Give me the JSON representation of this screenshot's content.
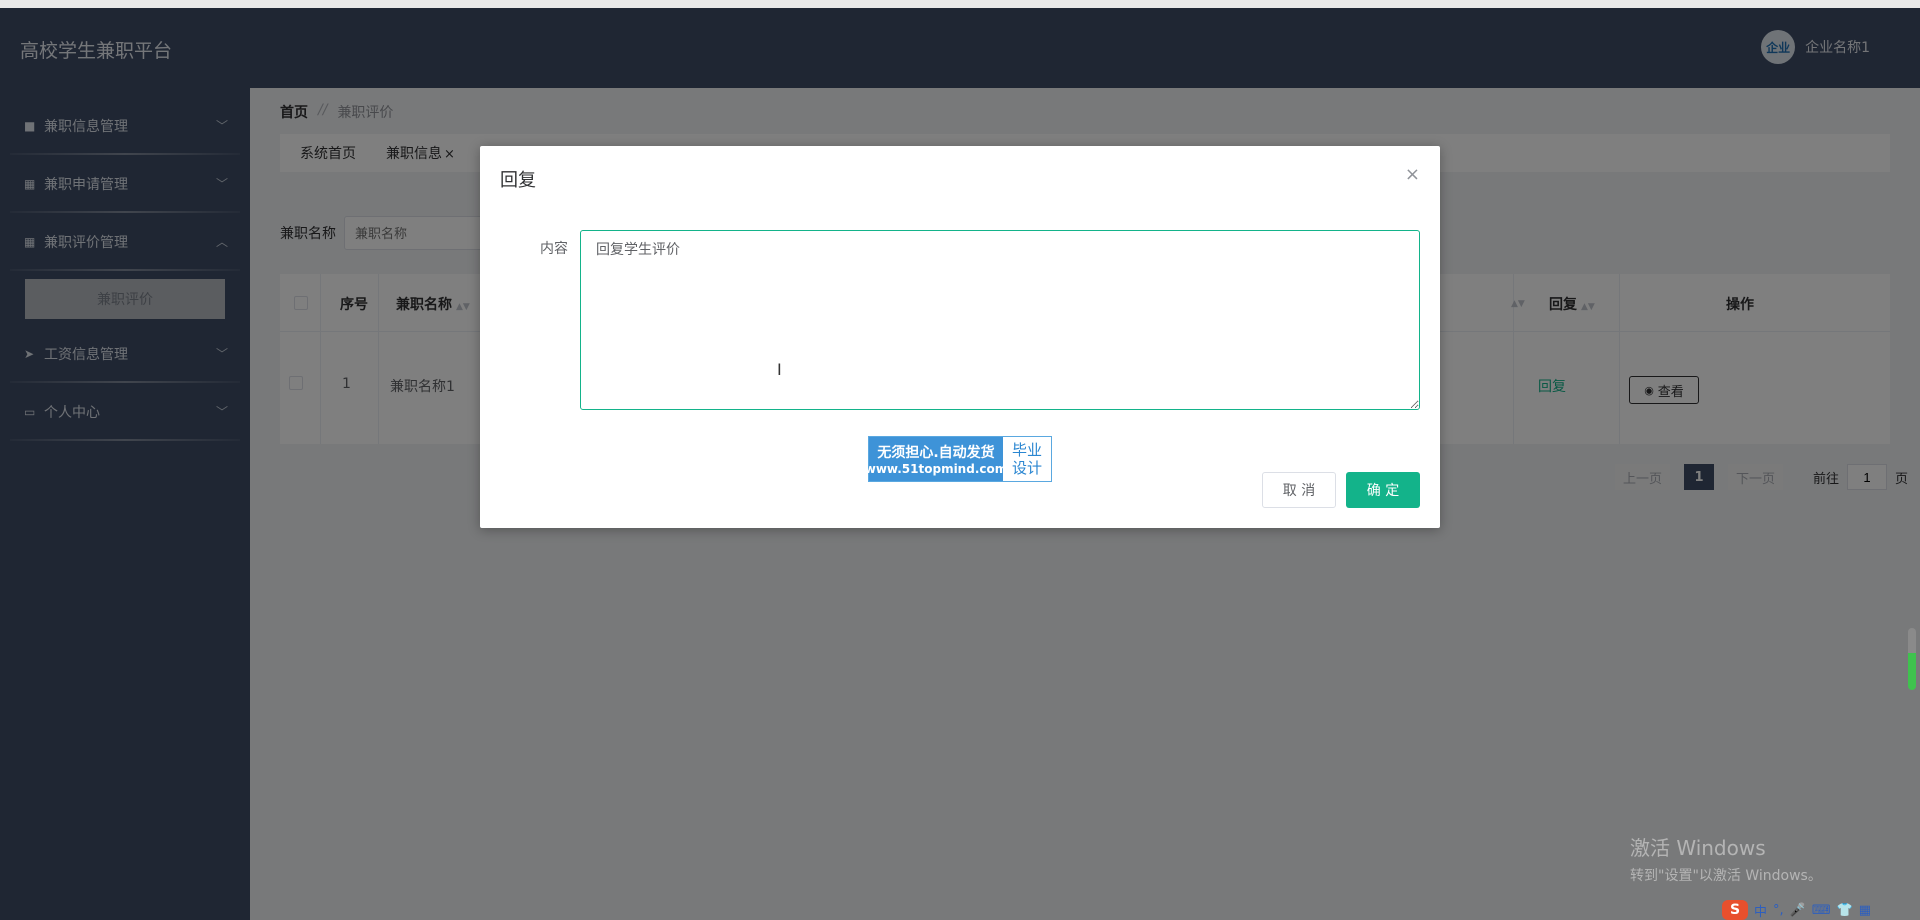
{
  "header": {
    "title": "高校学生兼职平台",
    "user_name": "企业名称1",
    "avatar_text": "企业"
  },
  "sidebar": {
    "items": [
      {
        "label": "兼职信息管理",
        "icon": "briefcase-icon",
        "expanded": false
      },
      {
        "label": "兼职申请管理",
        "icon": "grid-icon",
        "expanded": false
      },
      {
        "label": "兼职评价管理",
        "icon": "grid-icon",
        "expanded": true,
        "children": [
          {
            "label": "兼职评价"
          }
        ]
      },
      {
        "label": "工资信息管理",
        "icon": "paper-plane-icon",
        "expanded": false
      },
      {
        "label": "个人中心",
        "icon": "card-icon",
        "expanded": false
      }
    ]
  },
  "breadcrumb": {
    "home": "首页",
    "separator": "//",
    "current": "兼职评价"
  },
  "tags": [
    {
      "label": "系统首页"
    },
    {
      "label": "兼职信息",
      "close": "×"
    }
  ],
  "search": {
    "label": "兼职名称",
    "placeholder": "兼职名称"
  },
  "table": {
    "headers": {
      "index": "序号",
      "name": "兼职名称",
      "reply": "回复",
      "actions": "操作"
    },
    "rows": [
      {
        "index": "1",
        "name": "兼职名称1",
        "reply": "回复",
        "view": "查看"
      }
    ]
  },
  "pagination": {
    "prev": "上一页",
    "current": "1",
    "next": "下一页",
    "goto_label": "前往",
    "goto_value": "1",
    "page_suffix": "页"
  },
  "dialog": {
    "title": "回复",
    "close": "×",
    "field_label": "内容",
    "content": "回复学生评价",
    "cancel": "取 消",
    "confirm": "确 定"
  },
  "ad_banner": {
    "line1": "无须担心.自动发货",
    "line2": "www.51topmind.com",
    "right1": "毕业",
    "right2": "设计"
  },
  "watermark": {
    "line1": "激活 Windows",
    "line2": "转到\"设置\"以激活 Windows。"
  },
  "taskbar": {
    "ime_logo": "S",
    "ime_mode": "中"
  },
  "colors": {
    "sidebar_bg": "#3f4d67",
    "accent": "#13b38a",
    "overlay": "rgba(0,0,0,0.5)"
  }
}
